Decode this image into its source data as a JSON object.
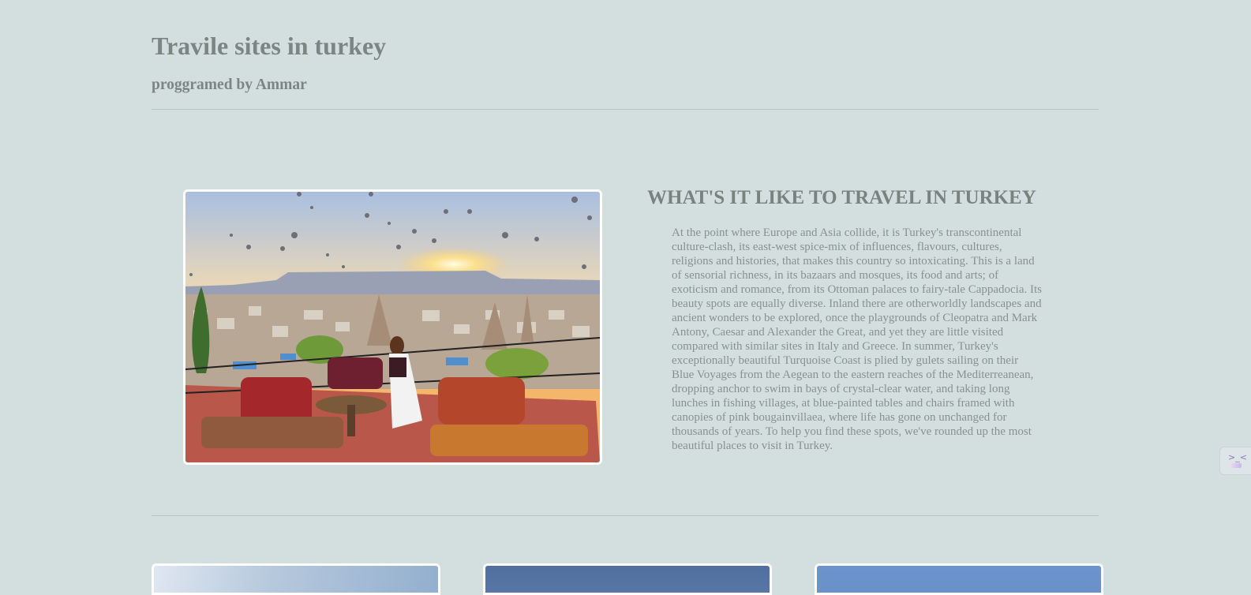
{
  "header": {
    "title": "Travile sites in turkey",
    "subtitle": "proggramed by Ammar"
  },
  "intro": {
    "heading": "WHAT'S IT LIKE TO TRAVEL IN TURKEY",
    "body": "At the point where Europe and Asia collide, it is Turkey's transcontinental culture-clash, its east-west spice-mix of influences, flavours, cultures, religions and histories, that makes this country so intoxicating. This is a land of sensorial richness, in its bazaars and mosques, its food and arts; of exoticism and romance, from its Ottoman palaces to fairy-tale Cappadocia. Its beauty spots are equally diverse. Inland there are otherworldly landscapes and ancient wonders to be explored, once the playgrounds of Cleopatra and Mark Antony, Caesar and Alexander the Great, and yet they are little visited compared with similar sites in Italy and Greece. In summer, Turkey's exceptionally beautiful Turquoise Coast is plied by gulets sailing on their Blue Voyages from the Aegean to the eastern reaches of the Mediterreanean, dropping anchor to swim in bays of crystal-clear water, and taking long lunches in fishing villages, at blue-painted tables and chairs framed with canopies of pink bougainvillaea, where life has gone on unchanged for thousands of years. To help you find these spots, we've rounded up the most beautiful places to visit in Turkey."
  },
  "colors": {
    "background": "#d3dfdf",
    "text": "#7b8683",
    "image_border": "#ffffff"
  },
  "side_widget": {
    "icon": "extension-icon",
    "glyph": ">_<"
  }
}
